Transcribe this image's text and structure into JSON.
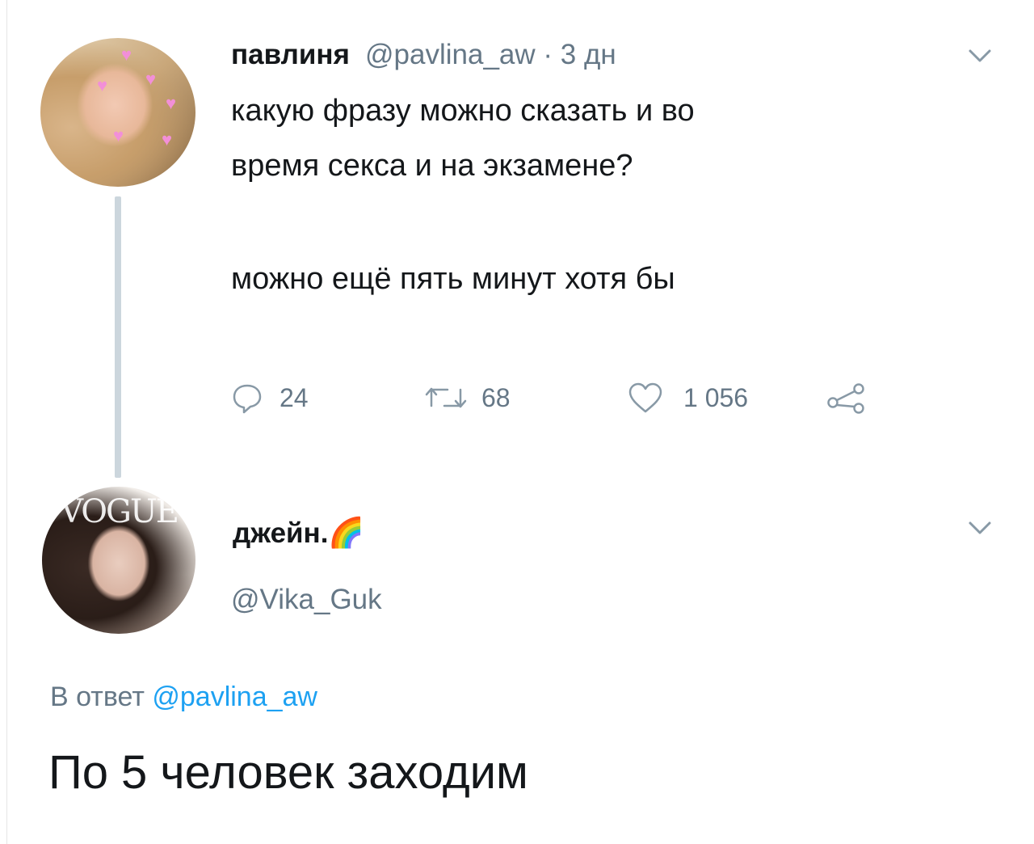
{
  "tweet": {
    "author_name": "павлиня",
    "author_handle": "@pavlina_aw",
    "time_separator": "·",
    "time": "3 дн",
    "text_lines": [
      "какую фразу можно сказать и во",
      "время секса и на экзамене?",
      "можно ещё пять минут хотя бы"
    ],
    "actions": {
      "replies": "24",
      "retweets": "68",
      "likes": "1 056"
    }
  },
  "reply": {
    "author_name": "джейн.",
    "author_emoji": "🌈",
    "author_handle": "@Vika_Guk",
    "avatar_text": "VOGUE",
    "in_reply_prefix": "В ответ",
    "in_reply_handle": "@pavlina_aw",
    "text": "По 5 человек заходим"
  },
  "colors": {
    "text_primary": "#14171a",
    "text_secondary": "#657786",
    "link": "#1da1f2",
    "thread_line": "#ccd6dd",
    "icon_gray": "#8899a6"
  },
  "icons": [
    "chevron-down-icon",
    "reply-icon",
    "retweet-icon",
    "like-icon",
    "share-icon",
    "rainbow-emoji"
  ]
}
